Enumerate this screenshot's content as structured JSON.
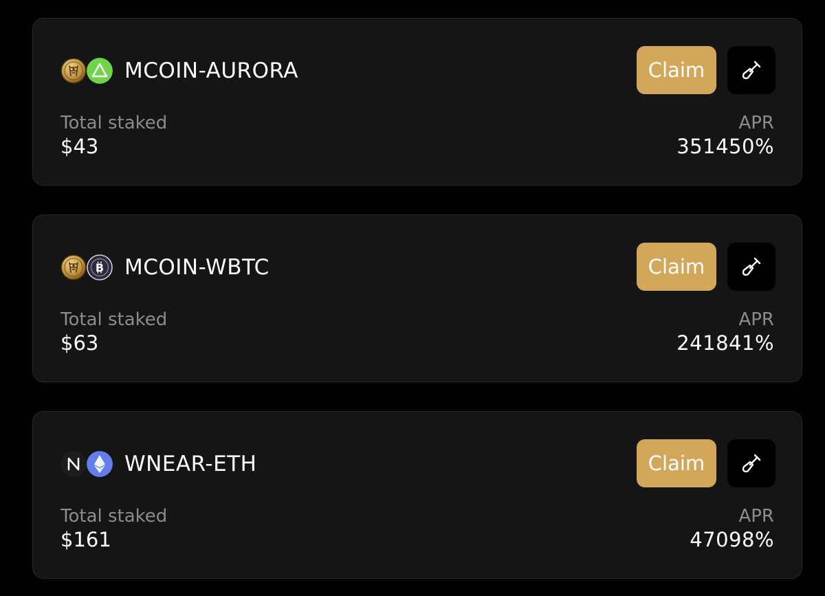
{
  "farms": [
    {
      "pair": "MCOIN-AURORA",
      "token1": {
        "icon": "mcoin-icon",
        "color": "#c9a24d"
      },
      "token2": {
        "icon": "aurora-icon",
        "color": "#70d44b"
      },
      "claim_label": "Claim",
      "tool_icon": "shovel-icon",
      "total_staked_label": "Total staked",
      "total_staked": "$43",
      "apr_label": "APR",
      "apr": "351450%"
    },
    {
      "pair": "MCOIN-WBTC",
      "token1": {
        "icon": "mcoin-icon",
        "color": "#c9a24d"
      },
      "token2": {
        "icon": "wbtc-icon",
        "color": "#2a2a3a"
      },
      "claim_label": "Claim",
      "tool_icon": "shovel-icon",
      "total_staked_label": "Total staked",
      "total_staked": "$63",
      "apr_label": "APR",
      "apr": "241841%"
    },
    {
      "pair": "WNEAR-ETH",
      "token1": {
        "icon": "near-icon",
        "color": "#1d1d1d"
      },
      "token2": {
        "icon": "eth-icon",
        "color": "#627eea"
      },
      "claim_label": "Claim",
      "tool_icon": "shovel-icon",
      "total_staked_label": "Total staked",
      "total_staked": "$161",
      "apr_label": "APR",
      "apr": "47098%"
    }
  ],
  "colors": {
    "background": "#000000",
    "card": "#151515",
    "accent_claim": "#d3a75a",
    "muted_text": "#8c8c8c"
  }
}
